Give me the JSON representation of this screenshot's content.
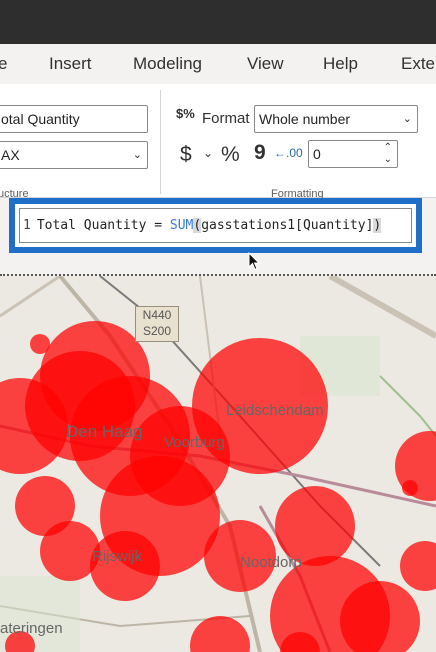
{
  "menu": {
    "items": [
      "e",
      "Insert",
      "Modeling",
      "View",
      "Help",
      "Exter"
    ]
  },
  "ribbon": {
    "name_field": "otal Quantity",
    "type_field": "AX",
    "structure_label": "ucture",
    "format_icon": "$%",
    "format_label": "Format",
    "format_value": "Whole number",
    "dollar": "$",
    "percent": "%",
    "comma": "9",
    "decimal_icon": "←.00",
    "decimal_places": "0",
    "formatting_label": "Formatting"
  },
  "formula": {
    "line_number": "1",
    "prefix": "Total Quantity = ",
    "function": "SUM",
    "open_paren": "(",
    "argument": "gasstations1[Quantity]",
    "close_paren": ")"
  },
  "map": {
    "labels": {
      "road_1": "N440",
      "road_2": "S200",
      "leidschendam": "Leidschendam",
      "voorburg": "Voorburg",
      "rijswijk": "Rijswijk",
      "nootdorp": "Nootdorp",
      "wateringen": "ateringen",
      "den_haag": "Den Haag"
    },
    "bubble_color": "#ff0000"
  }
}
